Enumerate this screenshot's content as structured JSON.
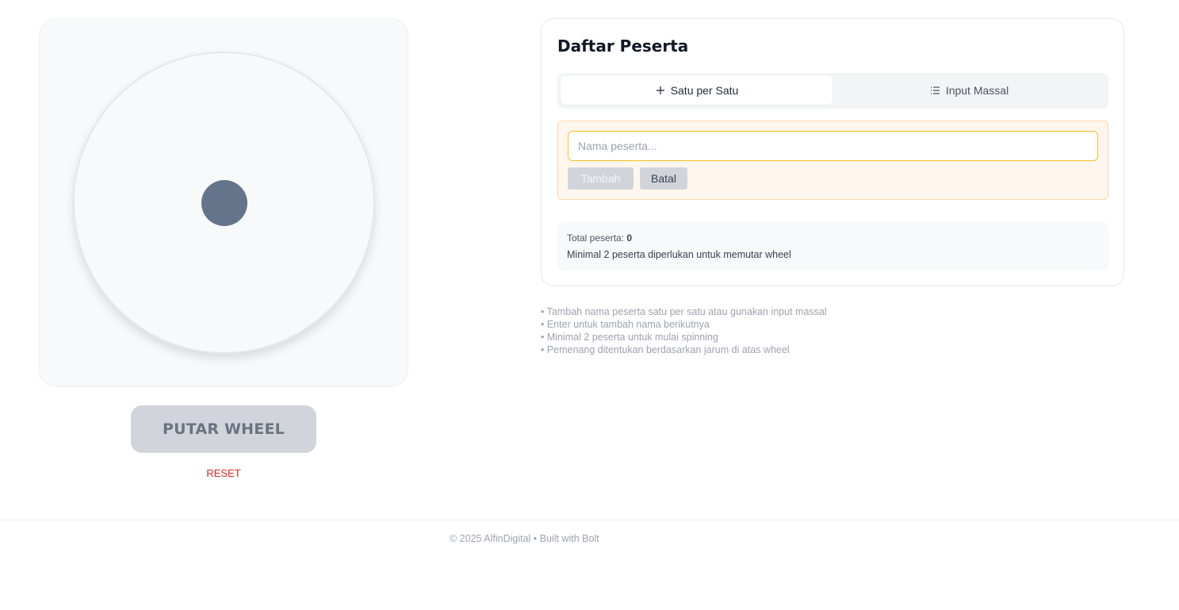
{
  "wheel": {
    "spin_label": "PUTAR WHEEL",
    "reset_label": "RESET"
  },
  "participants": {
    "title": "Daftar Peserta",
    "tabs": [
      {
        "label": "Satu per Satu",
        "icon": "plus-icon",
        "active": true
      },
      {
        "label": "Input Massal",
        "icon": "list-icon",
        "active": false
      }
    ],
    "input": {
      "placeholder": "Nama peserta...",
      "value": ""
    },
    "add_label": "Tambah",
    "cancel_label": "Batal",
    "total_label": "Total peserta:",
    "total_count": "0",
    "min_notice": "Minimal 2 peserta diperlukan untuk memutar wheel"
  },
  "tips": [
    "• Tambah nama peserta satu per satu atau gunakan input massal",
    "• Enter untuk tambah nama berikutnya",
    "• Minimal 2 peserta untuk mulai spinning",
    "• Pemenang ditentukan berdasarkan jarum di atas wheel"
  ],
  "footer": {
    "text": "© 2025 AlfinDigital • Built with Bolt"
  },
  "colors": {
    "accent_reset": "#dc2626",
    "hub": "#64748b",
    "form_bg": "#fff7ed",
    "input_border": "#fbbf24"
  }
}
